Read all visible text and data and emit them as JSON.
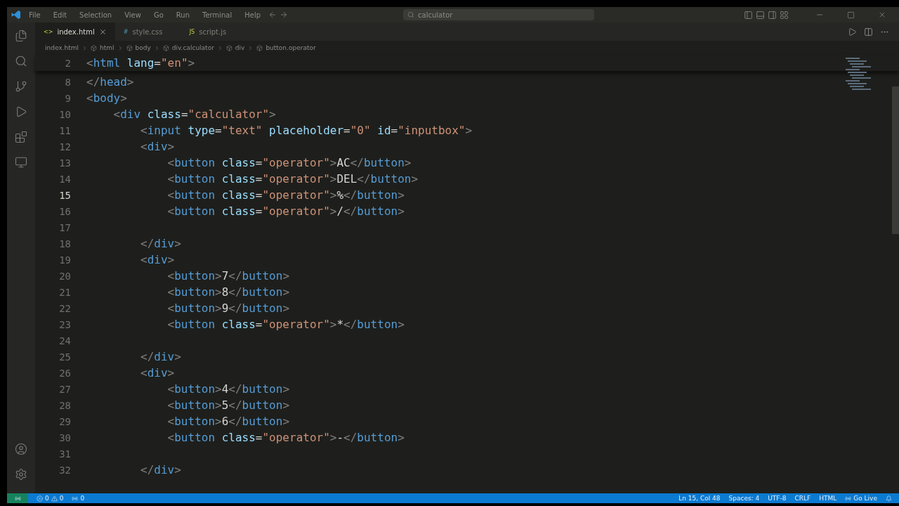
{
  "menu": [
    "File",
    "Edit",
    "Selection",
    "View",
    "Go",
    "Run",
    "Terminal",
    "Help"
  ],
  "search": {
    "value": "calculator"
  },
  "tabs": [
    {
      "label": "index.html",
      "icon": "<>",
      "selected": true
    },
    {
      "label": "style.css",
      "icon": "#",
      "selected": false
    },
    {
      "label": "script.js",
      "icon": "JS",
      "selected": false
    }
  ],
  "breadcrumb": [
    "index.html",
    "html",
    "body",
    "div.calculator",
    "div",
    "button.operator"
  ],
  "sticky_lines": [
    {
      "number": "2",
      "tokens": [
        {
          "kind": "bracket",
          "text": "<"
        },
        {
          "kind": "tag",
          "text": "html"
        },
        {
          "kind": "attr",
          "text": " lang"
        },
        {
          "kind": "punct",
          "text": "="
        },
        {
          "kind": "string",
          "text": "\"en\""
        },
        {
          "kind": "bracket",
          "text": ">"
        }
      ]
    }
  ],
  "lines": [
    {
      "number": "8",
      "selected": false,
      "tokens": [
        {
          "kind": "bracket",
          "text": "</"
        },
        {
          "kind": "tag",
          "text": "head"
        },
        {
          "kind": "bracket",
          "text": ">"
        }
      ]
    },
    {
      "number": "9",
      "selected": false,
      "tokens": [
        {
          "kind": "bracket",
          "text": "<"
        },
        {
          "kind": "tag",
          "text": "body"
        },
        {
          "kind": "bracket",
          "text": ">"
        }
      ]
    },
    {
      "number": "10",
      "selected": false,
      "tokens": [
        {
          "kind": "bracket",
          "text": "    <"
        },
        {
          "kind": "tag",
          "text": "div"
        },
        {
          "kind": "attr",
          "text": " class"
        },
        {
          "kind": "punct",
          "text": "="
        },
        {
          "kind": "string",
          "text": "\"calculator\""
        },
        {
          "kind": "bracket",
          "text": ">"
        }
      ]
    },
    {
      "number": "11",
      "selected": false,
      "tokens": [
        {
          "kind": "bracket",
          "text": "        <"
        },
        {
          "kind": "tag",
          "text": "input"
        },
        {
          "kind": "attr",
          "text": " type"
        },
        {
          "kind": "punct",
          "text": "="
        },
        {
          "kind": "string",
          "text": "\"text\""
        },
        {
          "kind": "attr",
          "text": " placeholder"
        },
        {
          "kind": "punct",
          "text": "="
        },
        {
          "kind": "string",
          "text": "\"0\""
        },
        {
          "kind": "attr",
          "text": " id"
        },
        {
          "kind": "punct",
          "text": "="
        },
        {
          "kind": "string",
          "text": "\"inputbox\""
        },
        {
          "kind": "bracket",
          "text": ">"
        }
      ]
    },
    {
      "number": "12",
      "selected": false,
      "tokens": [
        {
          "kind": "bracket",
          "text": "        <"
        },
        {
          "kind": "tag",
          "text": "div"
        },
        {
          "kind": "bracket",
          "text": ">"
        }
      ]
    },
    {
      "number": "13",
      "selected": false,
      "tokens": [
        {
          "kind": "bracket",
          "text": "            <"
        },
        {
          "kind": "tag",
          "text": "button"
        },
        {
          "kind": "attr",
          "text": " class"
        },
        {
          "kind": "punct",
          "text": "="
        },
        {
          "kind": "string",
          "text": "\"operator\""
        },
        {
          "kind": "bracket",
          "text": ">"
        },
        {
          "kind": "text",
          "text": "AC"
        },
        {
          "kind": "bracket",
          "text": "</"
        },
        {
          "kind": "tag",
          "text": "button"
        },
        {
          "kind": "bracket",
          "text": ">"
        }
      ]
    },
    {
      "number": "14",
      "selected": false,
      "tokens": [
        {
          "kind": "bracket",
          "text": "            <"
        },
        {
          "kind": "tag",
          "text": "button"
        },
        {
          "kind": "attr",
          "text": " class"
        },
        {
          "kind": "punct",
          "text": "="
        },
        {
          "kind": "string",
          "text": "\"operator\""
        },
        {
          "kind": "bracket",
          "text": ">"
        },
        {
          "kind": "text",
          "text": "DEL"
        },
        {
          "kind": "bracket",
          "text": "</"
        },
        {
          "kind": "tag",
          "text": "button"
        },
        {
          "kind": "bracket",
          "text": ">"
        }
      ]
    },
    {
      "number": "15",
      "selected": true,
      "tokens": [
        {
          "kind": "bracket",
          "text": "            <"
        },
        {
          "kind": "tag",
          "text": "button"
        },
        {
          "kind": "attr",
          "text": " class"
        },
        {
          "kind": "punct",
          "text": "="
        },
        {
          "kind": "string",
          "text": "\"operator\""
        },
        {
          "kind": "bracket",
          "text": ">"
        },
        {
          "kind": "text",
          "text": "%"
        },
        {
          "kind": "bracket",
          "text": "</"
        },
        {
          "kind": "tag",
          "text": "button"
        },
        {
          "kind": "bracket",
          "text": ">"
        }
      ]
    },
    {
      "number": "16",
      "selected": false,
      "tokens": [
        {
          "kind": "bracket",
          "text": "            <"
        },
        {
          "kind": "tag",
          "text": "button"
        },
        {
          "kind": "attr",
          "text": " class"
        },
        {
          "kind": "punct",
          "text": "="
        },
        {
          "kind": "string",
          "text": "\"operator\""
        },
        {
          "kind": "bracket",
          "text": ">"
        },
        {
          "kind": "text",
          "text": "/"
        },
        {
          "kind": "bracket",
          "text": "</"
        },
        {
          "kind": "tag",
          "text": "button"
        },
        {
          "kind": "bracket",
          "text": ">"
        }
      ]
    },
    {
      "number": "17",
      "selected": false
    },
    {
      "number": "18",
      "selected": false,
      "tokens": [
        {
          "kind": "bracket",
          "text": "        </"
        },
        {
          "kind": "tag",
          "text": "div"
        },
        {
          "kind": "bracket",
          "text": ">"
        }
      ]
    },
    {
      "number": "19",
      "selected": false,
      "tokens": [
        {
          "kind": "bracket",
          "text": "        <"
        },
        {
          "kind": "tag",
          "text": "div"
        },
        {
          "kind": "bracket",
          "text": ">"
        }
      ]
    },
    {
      "number": "20",
      "selected": false,
      "tokens": [
        {
          "kind": "bracket",
          "text": "            <"
        },
        {
          "kind": "tag",
          "text": "button"
        },
        {
          "kind": "bracket",
          "text": ">"
        },
        {
          "kind": "text",
          "text": "7"
        },
        {
          "kind": "bracket",
          "text": "</"
        },
        {
          "kind": "tag",
          "text": "button"
        },
        {
          "kind": "bracket",
          "text": ">"
        }
      ]
    },
    {
      "number": "21",
      "selected": false,
      "tokens": [
        {
          "kind": "bracket",
          "text": "            <"
        },
        {
          "kind": "tag",
          "text": "button"
        },
        {
          "kind": "bracket",
          "text": ">"
        },
        {
          "kind": "text",
          "text": "8"
        },
        {
          "kind": "bracket",
          "text": "</"
        },
        {
          "kind": "tag",
          "text": "button"
        },
        {
          "kind": "bracket",
          "text": ">"
        }
      ]
    },
    {
      "number": "22",
      "selected": false,
      "tokens": [
        {
          "kind": "bracket",
          "text": "            <"
        },
        {
          "kind": "tag",
          "text": "button"
        },
        {
          "kind": "bracket",
          "text": ">"
        },
        {
          "kind": "text",
          "text": "9"
        },
        {
          "kind": "bracket",
          "text": "</"
        },
        {
          "kind": "tag",
          "text": "button"
        },
        {
          "kind": "bracket",
          "text": ">"
        }
      ]
    },
    {
      "number": "23",
      "selected": false,
      "tokens": [
        {
          "kind": "bracket",
          "text": "            <"
        },
        {
          "kind": "tag",
          "text": "button"
        },
        {
          "kind": "attr",
          "text": " class"
        },
        {
          "kind": "punct",
          "text": "="
        },
        {
          "kind": "string",
          "text": "\"operator\""
        },
        {
          "kind": "bracket",
          "text": ">"
        },
        {
          "kind": "text",
          "text": "*"
        },
        {
          "kind": "bracket",
          "text": "</"
        },
        {
          "kind": "tag",
          "text": "button"
        },
        {
          "kind": "bracket",
          "text": ">"
        }
      ]
    },
    {
      "number": "24",
      "selected": false
    },
    {
      "number": "25",
      "selected": false,
      "tokens": [
        {
          "kind": "bracket",
          "text": "        </"
        },
        {
          "kind": "tag",
          "text": "div"
        },
        {
          "kind": "bracket",
          "text": ">"
        }
      ]
    },
    {
      "number": "26",
      "selected": false,
      "tokens": [
        {
          "kind": "bracket",
          "text": "        <"
        },
        {
          "kind": "tag",
          "text": "div"
        },
        {
          "kind": "bracket",
          "text": ">"
        }
      ]
    },
    {
      "number": "27",
      "selected": false,
      "tokens": [
        {
          "kind": "bracket",
          "text": "            <"
        },
        {
          "kind": "tag",
          "text": "button"
        },
        {
          "kind": "bracket",
          "text": ">"
        },
        {
          "kind": "text",
          "text": "4"
        },
        {
          "kind": "bracket",
          "text": "</"
        },
        {
          "kind": "tag",
          "text": "button"
        },
        {
          "kind": "bracket",
          "text": ">"
        }
      ]
    },
    {
      "number": "28",
      "selected": false,
      "tokens": [
        {
          "kind": "bracket",
          "text": "            <"
        },
        {
          "kind": "tag",
          "text": "button"
        },
        {
          "kind": "bracket",
          "text": ">"
        },
        {
          "kind": "text",
          "text": "5"
        },
        {
          "kind": "bracket",
          "text": "</"
        },
        {
          "kind": "tag",
          "text": "button"
        },
        {
          "kind": "bracket",
          "text": ">"
        }
      ]
    },
    {
      "number": "29",
      "selected": false,
      "tokens": [
        {
          "kind": "bracket",
          "text": "            <"
        },
        {
          "kind": "tag",
          "text": "button"
        },
        {
          "kind": "bracket",
          "text": ">"
        },
        {
          "kind": "text",
          "text": "6"
        },
        {
          "kind": "bracket",
          "text": "</"
        },
        {
          "kind": "tag",
          "text": "button"
        },
        {
          "kind": "bracket",
          "text": ">"
        }
      ]
    },
    {
      "number": "30",
      "selected": false,
      "tokens": [
        {
          "kind": "bracket",
          "text": "            <"
        },
        {
          "kind": "tag",
          "text": "button"
        },
        {
          "kind": "attr",
          "text": " class"
        },
        {
          "kind": "punct",
          "text": "="
        },
        {
          "kind": "string",
          "text": "\"operator\""
        },
        {
          "kind": "bracket",
          "text": ">"
        },
        {
          "kind": "text",
          "text": "-"
        },
        {
          "kind": "bracket",
          "text": "</"
        },
        {
          "kind": "tag",
          "text": "button"
        },
        {
          "kind": "bracket",
          "text": ">"
        }
      ]
    },
    {
      "number": "31",
      "selected": false
    },
    {
      "number": "32",
      "selected": false,
      "tokens": [
        {
          "kind": "bracket",
          "text": "        </"
        },
        {
          "kind": "tag",
          "text": "div"
        },
        {
          "kind": "bracket",
          "text": ">"
        }
      ]
    }
  ],
  "status_bar": {
    "errors": "0",
    "warnings": "0",
    "ports": "0",
    "items": [
      "Ln 15, Col 48",
      "Spaces: 4",
      "UTF-8",
      "CRLF",
      "HTML"
    ],
    "live": "Go Live"
  }
}
